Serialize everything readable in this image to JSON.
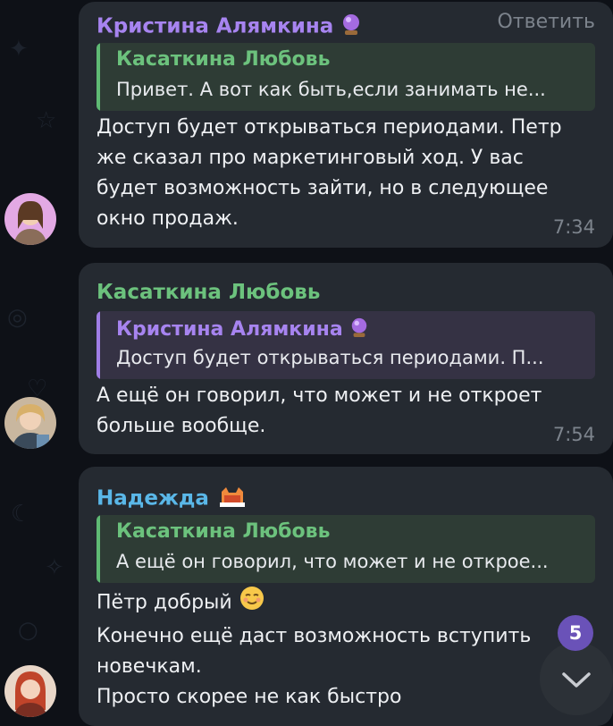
{
  "colors": {
    "chat_background": "#0e1117",
    "bubble": "#252a31",
    "name_purple": "#a784f0",
    "name_green": "#6cc27d",
    "name_blue": "#5ab7e8",
    "timestamp": "#7d848d",
    "badge": "#6a52b8"
  },
  "messages": [
    {
      "sender": "Кристина Алямкина",
      "sender_emoji": "crystal-ball-icon",
      "reply_action": "Ответить",
      "quote": {
        "author": "Касаткина Любовь",
        "text": "Привет. А вот как быть,если занимать не..."
      },
      "lines": [
        "Доступ будет открываться периодами. Петр",
        "же сказал про маркетинговый ход. У вас",
        "будет возможность зайти, но в следующее",
        "окно продаж."
      ],
      "time": "7:34"
    },
    {
      "sender": "Касаткина Любовь",
      "quote": {
        "author": "Кристина Алямкина",
        "author_emoji": "crystal-ball-icon",
        "text": "Доступ будет открываться периодами. П..."
      },
      "lines": [
        "А ещё он говорил, что может и не откроет",
        "больше вообще."
      ],
      "time": "7:54"
    },
    {
      "sender": "Надежда",
      "sender_emoji": "cat-icon",
      "quote": {
        "author": "Касаткина Любовь",
        "text": "А ещё он говорил, что может и не откроe..."
      },
      "lines": [
        "Пётр добрый",
        "Конечно ещё даст возможность вступить",
        "новечкам.",
        "Просто скорее не как быстро"
      ],
      "line1_emoji": "relieved-face-icon"
    }
  ],
  "unread_count": "5"
}
